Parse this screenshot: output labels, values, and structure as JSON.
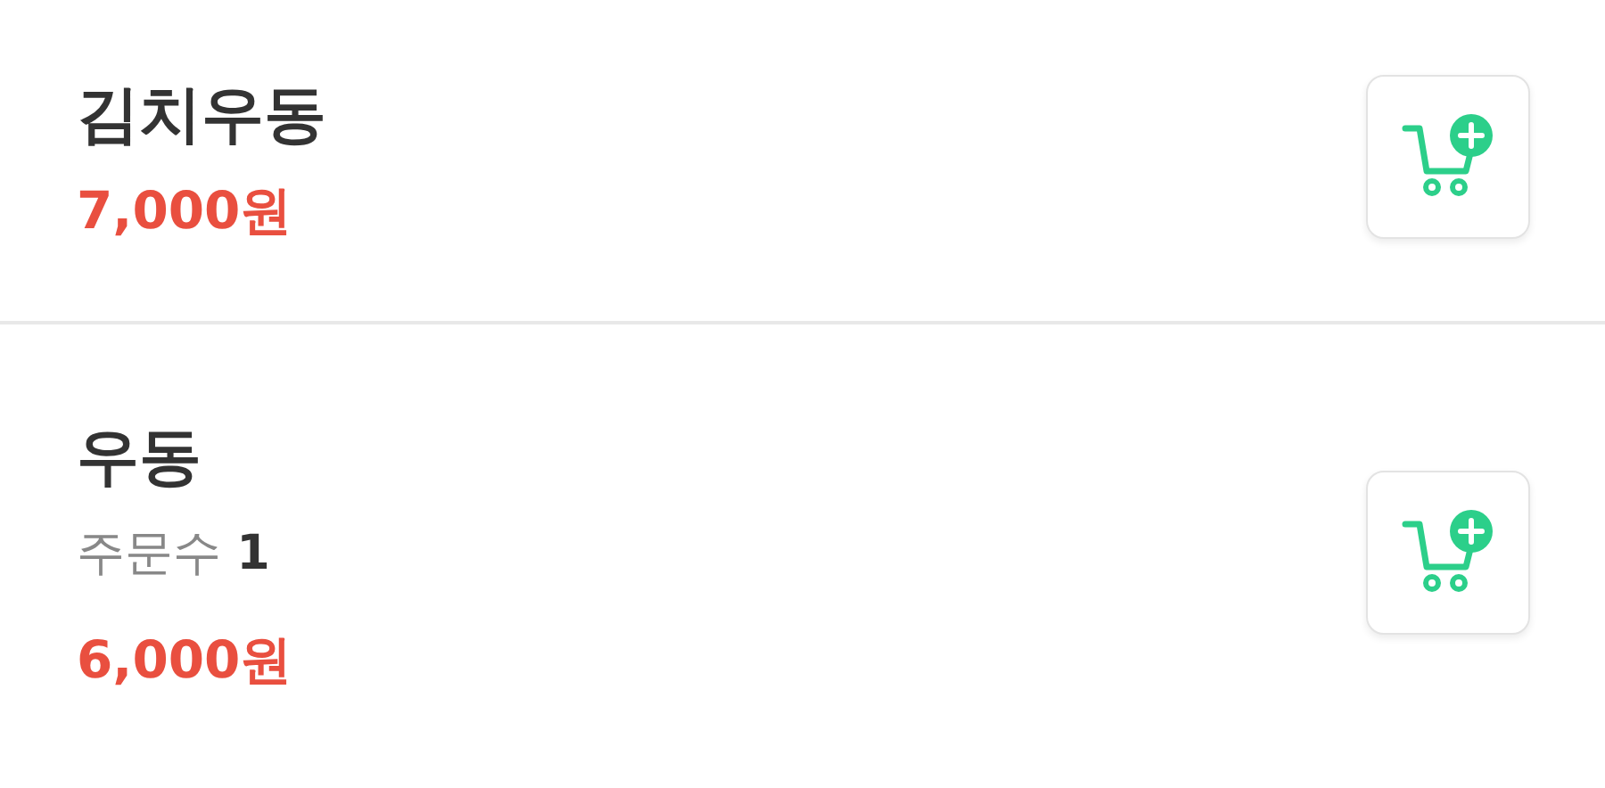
{
  "menu_items": [
    {
      "name": "김치우동",
      "price": "7,000원"
    },
    {
      "name": "우동",
      "order_count": "주문수 **1**",
      "price": "6,000원"
    }
  ]
}
